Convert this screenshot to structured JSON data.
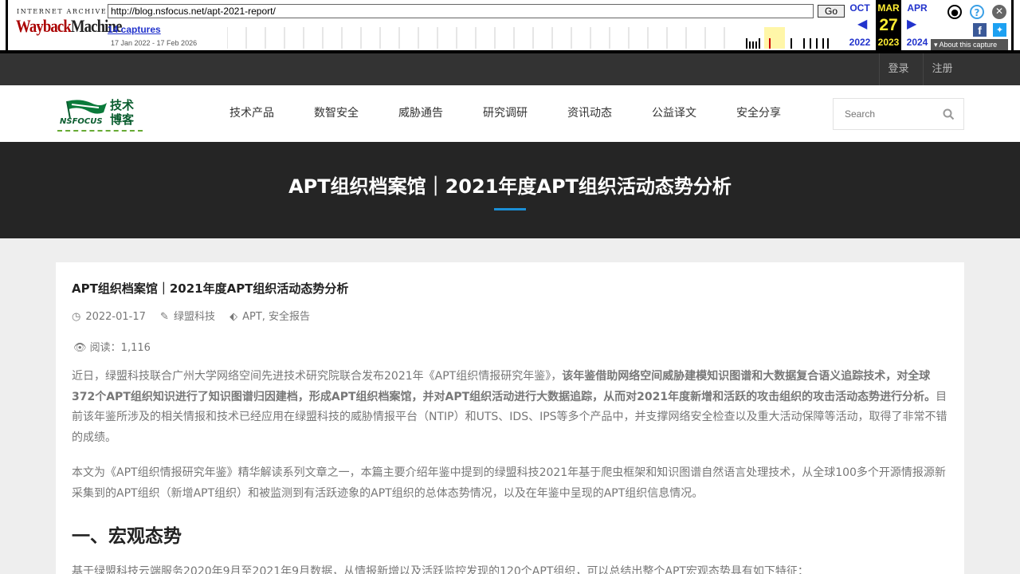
{
  "wayback": {
    "logo_top": "INTERNET ARCHIVE",
    "logo_text_w": "Wayback",
    "logo_text_m": "Machine",
    "url": "http://blog.nsfocus.net/apt-2021-report/",
    "go": "Go",
    "captures": "14 captures",
    "range": "17 Jan 2022 - 17 Feb 2026",
    "prev_month": "OCT",
    "prev_year": "2022",
    "cur_month": "MAR",
    "cur_day": "27",
    "cur_year": "2023",
    "next_month": "APR",
    "next_year": "2024",
    "about": "About this capture"
  },
  "topbar": {
    "login": "登录",
    "register": "注册"
  },
  "logo": {
    "en": "NSFOCUS",
    "cn": "技术博客"
  },
  "nav": [
    "技术产品",
    "数智安全",
    "威胁通告",
    "研究调研",
    "资讯动态",
    "公益译文",
    "安全分享"
  ],
  "search": {
    "placeholder": "Search"
  },
  "banner": {
    "title": "APT组织档案馆｜2021年度APT组织活动态势分析"
  },
  "article": {
    "title": "APT组织档案馆｜2021年度APT组织活动态势分析",
    "date": "2022-01-17",
    "author": "绿盟科技",
    "tags": "APT, 安全报告",
    "views_label": "阅读：",
    "views": "1,116",
    "p1_a": "近日，绿盟科技联合广州大学网络空间先进技术研究院联合发布2021年《APT组织情报研究年鉴》，",
    "p1_b": "该年鉴借助网络空间威胁建模知识图谱和大数据复合语义追踪技术，对全球372个APT组织知识进行了知识图谱归因建档，形成APT组织档案馆，并对APT组织活动进行大数据追踪，从而对2021年度新增和活跃的攻击组织的攻击活动态势进行分析。",
    "p1_c": "目前该年鉴所涉及的相关情报和技术已经应用在绿盟科技的威胁情报平台（NTIP）和UTS、IDS、IPS等多个产品中，并支撑网络安全检查以及重大活动保障等活动，取得了非常不错的成绩。",
    "p2": "本文为《APT组织情报研究年鉴》精华解读系列文章之一，本篇主要介绍年鉴中提到的绿盟科技2021年基于爬虫框架和知识图谱自然语言处理技术，从全球100多个开源情报源新采集到的APT组织（新增APT组织）和被监测到有活跃迹象的APT组织的总体态势情况，以及在年鉴中呈现的APT组织信息情况。",
    "h2": "一、宏观态势",
    "p3": "基于绿盟科技云端服务2020年9月至2021年9月数据，从情报新增以及活跃监控发现的120个APT组织，可以总结出整个APT宏观态势具有如下特征："
  },
  "colors": {
    "accent": "#1b8fd6",
    "banner_bg": "#252525",
    "topbar_bg": "#333333"
  }
}
